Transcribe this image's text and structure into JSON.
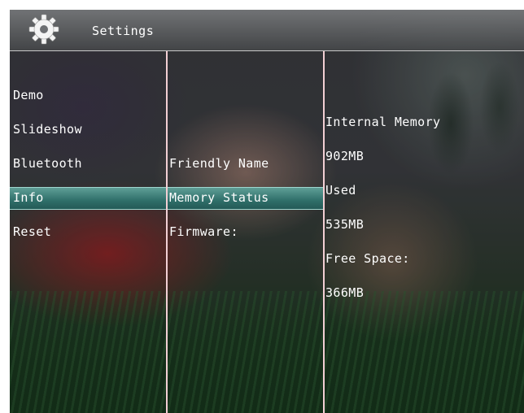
{
  "header": {
    "title": "Settings",
    "icon": "gear-icon"
  },
  "menu_column": {
    "items": [
      {
        "label": "Demo"
      },
      {
        "label": "Slideshow"
      },
      {
        "label": "Bluetooth"
      },
      {
        "label": "Info",
        "selected": true
      },
      {
        "label": "Reset"
      }
    ]
  },
  "info_column": {
    "items": [
      {
        "label": "Friendly Name"
      },
      {
        "label": "Memory Status",
        "selected": true
      },
      {
        "label": "Firmware:"
      }
    ]
  },
  "memory_column": {
    "internal_label": "Internal Memory",
    "internal_value": "902MB",
    "used_label": "Used",
    "used_value": "535MB",
    "free_label": "Free Space:",
    "free_value": "366MB"
  },
  "colors": {
    "highlight": "#2f6f6a",
    "divider": "#f2cfd4",
    "text": "#ffffff"
  }
}
